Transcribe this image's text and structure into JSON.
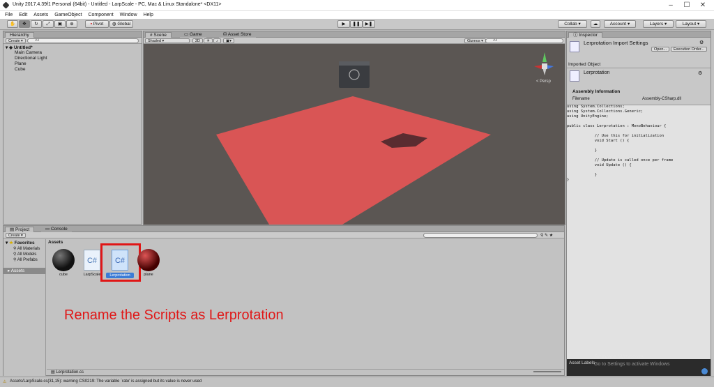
{
  "window": {
    "title": "Unity 2017.4.39f1 Personal (64bit) - Untitled - LarpScale - PC, Mac & Linux Standalone* <DX11>"
  },
  "menu": [
    "File",
    "Edit",
    "Assets",
    "GameObject",
    "Component",
    "Window",
    "Help"
  ],
  "toolbar": {
    "pivot": "Pivot",
    "global": "Global",
    "collab": "Collab",
    "account": "Account",
    "layers": "Layers",
    "layout": "Layout"
  },
  "hierarchy": {
    "tab": "Hierarchy",
    "create": "Create",
    "search": "All",
    "scene": "Untitled*",
    "items": [
      "Main Camera",
      "Directional Light",
      "Plane",
      "Cube"
    ]
  },
  "scene": {
    "tabs": [
      "Scene",
      "Game",
      "Asset Store"
    ],
    "shaded": "Shaded",
    "twod": "2D",
    "gizmos": "Gizmos",
    "search": "All",
    "persp": "< Persp"
  },
  "project": {
    "tabs": [
      "Project",
      "Console"
    ],
    "create": "Create",
    "favorites": "Favorites",
    "fav_items": [
      "All Materials",
      "All Models",
      "All Prefabs"
    ],
    "assets_folder": "Assets",
    "breadcrumb": "Assets",
    "footer_file": "Lerprotation.cs"
  },
  "assets": [
    {
      "name": "cube",
      "kind": "sphere-dark"
    },
    {
      "name": "LarpScale",
      "kind": "script"
    },
    {
      "name": "Lerprotation",
      "kind": "script"
    },
    {
      "name": "plane",
      "kind": "sphere-red"
    }
  ],
  "annotation": "Rename the Scripts as Lerprotation",
  "inspector": {
    "tab": "Inspector",
    "title": "Lerprotation Import Settings",
    "open": "Open...",
    "exec": "Execution Order...",
    "imported": "Imported Object",
    "obj_name": "Lerprotation",
    "assembly": "Assembly Information",
    "filename_label": "Filename",
    "filename_value": "Assembly-CSharp.dll",
    "asset_labels": "Asset Labels"
  },
  "code": "using System.Collections;\nusing System.Collections.Generic;\nusing UnityEngine;\n\npublic class Lerprotation : MonoBehaviour {\n\n            // Use this for initialization\n            void Start () {\n\n            }\n\n            // Update is called once per frame\n            void Update () {\n\n            }\n}",
  "status": "Assets/LarpScale.cs(31,15): warning CS0219: The variable `rate' is assigned but its value is never used",
  "watermark": {
    "line1": "Activate Windows",
    "line2": "Go to Settings to activate Windows"
  }
}
